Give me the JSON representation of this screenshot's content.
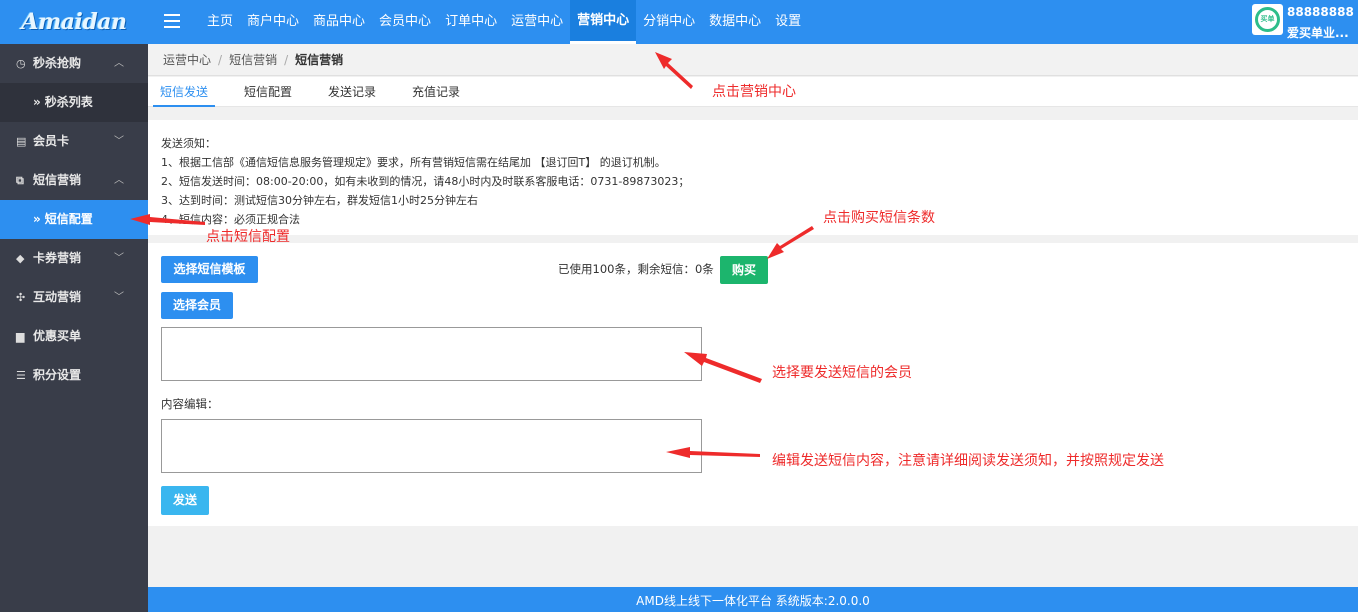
{
  "header": {
    "logo": "Amaidan",
    "nav": [
      "主页",
      "商户中心",
      "商品中心",
      "会员中心",
      "订单中心",
      "运营中心",
      "营销中心",
      "分销中心",
      "数据中心",
      "设置"
    ],
    "user_id": "88888888",
    "user_name": "爱买单业...",
    "avatar_text": "买单"
  },
  "sidebar": {
    "items": [
      {
        "label": "秒杀抢购",
        "icon": "clock-icon",
        "expanded": true
      },
      {
        "label": "秒杀列表",
        "sub": true
      },
      {
        "label": "会员卡",
        "icon": "card-icon",
        "expanded": false
      },
      {
        "label": "短信营销",
        "icon": "copy-icon",
        "expanded": true
      },
      {
        "label": "短信配置",
        "sub": true,
        "active": true
      },
      {
        "label": "卡券营销",
        "icon": "tag-icon",
        "expanded": false
      },
      {
        "label": "互动营销",
        "icon": "puzzle-icon",
        "expanded": false
      },
      {
        "label": "优惠买单",
        "icon": "briefcase-icon"
      },
      {
        "label": "积分设置",
        "icon": "database-icon"
      }
    ]
  },
  "breadcrumb": [
    "运营中心",
    "短信营销",
    "短信营销"
  ],
  "tabs": [
    "短信发送",
    "短信配置",
    "发送记录",
    "充值记录"
  ],
  "notice": [
    "发送须知：",
    "1、根据工信部《通信短信息服务管理规定》要求，所有营销短信需在结尾加 【退订回T】 的退订机制。",
    "2、短信发送时间：08:00-20:00，如有未收到的情况，请48小时内及时联系客服电话：0731-89873023；",
    "3、达到时间：测试短信30分钟左右，群发短信1小时25分钟左右",
    "4、短信内容：必须正规合法"
  ],
  "form": {
    "select_template": "选择短信模板",
    "select_member": "选择会员",
    "usage": "已使用100条，剩余短信：0条",
    "buy": "购买",
    "content_label": "内容编辑：",
    "send": "发送"
  },
  "annotations": {
    "click_marketing": "点击营销中心",
    "click_sms_config": "点击短信配置",
    "click_buy": "点击购买短信条数",
    "select_members": "选择要发送短信的会员",
    "edit_content": "编辑发送短信内容，注意请详细阅读发送须知，并按照规定发送"
  },
  "footer": "AMD线上线下一体化平台 系统版本:2.0.0.0",
  "colors": {
    "primary": "#2d8ff0",
    "sidebar": "#393d49",
    "buy": "#1cb56d",
    "annotation": "#ee2b2b"
  }
}
